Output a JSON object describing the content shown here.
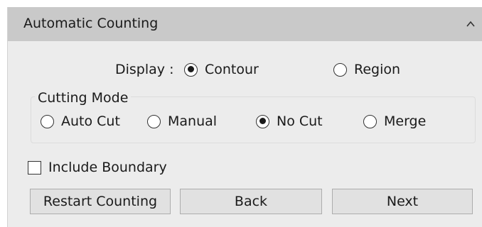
{
  "panel": {
    "title": "Automatic Counting",
    "collapse_icon": "chevron-up-icon"
  },
  "display": {
    "label": "Display :",
    "options": [
      "Contour",
      "Region"
    ],
    "selected": "Contour"
  },
  "cutting_mode": {
    "label": "Cutting Mode",
    "options": [
      "Auto Cut",
      "Manual",
      "No Cut",
      "Merge"
    ],
    "selected": "No Cut"
  },
  "include_boundary": {
    "label": "Include Boundary",
    "checked": false
  },
  "buttons": {
    "restart": "Restart Counting",
    "back": "Back",
    "next": "Next"
  }
}
